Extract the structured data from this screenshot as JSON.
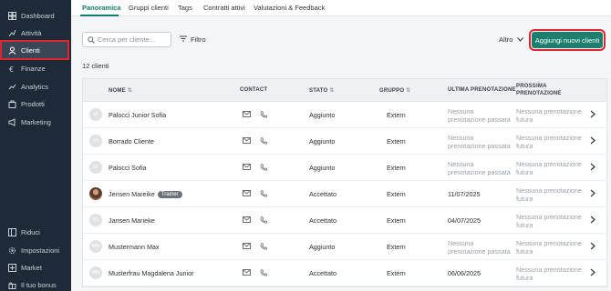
{
  "sidebar": {
    "items": [
      {
        "label": "Dashboard",
        "icon": "dashboard-icon"
      },
      {
        "label": "Attività",
        "icon": "activity-icon"
      },
      {
        "label": "Clienti",
        "icon": "user-icon"
      },
      {
        "label": "Finanze",
        "icon": "finance-icon"
      },
      {
        "label": "Analytics",
        "icon": "analytics-icon"
      },
      {
        "label": "Prodotti",
        "icon": "products-icon"
      },
      {
        "label": "Marketing",
        "icon": "marketing-icon"
      }
    ],
    "bottom_items": [
      {
        "label": "Riduci",
        "icon": "collapse-icon"
      },
      {
        "label": "Impostazioni",
        "icon": "settings-icon"
      },
      {
        "label": "Market",
        "icon": "market-icon"
      },
      {
        "label": "Il tuo bonus",
        "icon": "bonus-icon"
      }
    ]
  },
  "tabs": [
    "Panoramica",
    "Gruppi clienti",
    "Tags",
    "Contratti attivi",
    "Valutazioni & Feedback"
  ],
  "toolbar": {
    "search_placeholder": "Cerca per cliente...",
    "filter_label": "Filtro",
    "altro_label": "Altro",
    "add_label": "Aggiungi nuovi clienti"
  },
  "count_label": "12 clienti",
  "table": {
    "headers": {
      "name": "NOME",
      "contact": "CONTACT",
      "status": "STATO",
      "group": "GRUPPO",
      "last": "ULTIMA PRENOTAZIONE",
      "next_line1": "PROSSIMA",
      "next_line2": "PRENOTAZIONE"
    },
    "rows": [
      {
        "initials": "SP",
        "name": "Palocci Junior Sofia",
        "badge": "",
        "status": "Aggiunto",
        "group": "Extern",
        "last": "Nessuna prenotazione passata",
        "next": "Nessuna prenotazione futura"
      },
      {
        "initials": "CB",
        "name": "Borrado Cliente",
        "badge": "",
        "status": "Aggiunto",
        "group": "Extern",
        "last": "Nessuna prenotazione passata",
        "next": "Nessuna prenotazione futura"
      },
      {
        "initials": "SP",
        "name": "Palocci Sofia",
        "badge": "",
        "status": "Aggiunto",
        "group": "Extern",
        "last": "Nessuna prenotazione passata",
        "next": "Nessuna prenotazione futura"
      },
      {
        "initials": "",
        "name": "Jensen Mareike",
        "badge": "Trainer",
        "status": "Accettato",
        "group": "Extern",
        "last": "11/07/2025",
        "next": "Nessuna prenotazione futura"
      },
      {
        "initials": "MJ",
        "name": "Jansen Marieke",
        "badge": "",
        "status": "Accettato",
        "group": "Extern",
        "last": "04/07/2025",
        "next": "Nessuna prenotazione futura"
      },
      {
        "initials": "MM",
        "name": "Mustermann Max",
        "badge": "",
        "status": "Aggiunto",
        "group": "Extern",
        "last": "Nessuna prenotazione passata",
        "next": "Nessuna prenotazione futura"
      },
      {
        "initials": "MM",
        "name": "Musterfrau Magdalena Junior",
        "badge": "",
        "status": "Accettato",
        "group": "Extern",
        "last": "06/06/2025",
        "next": "Nessuna prenotazione futura"
      }
    ]
  }
}
